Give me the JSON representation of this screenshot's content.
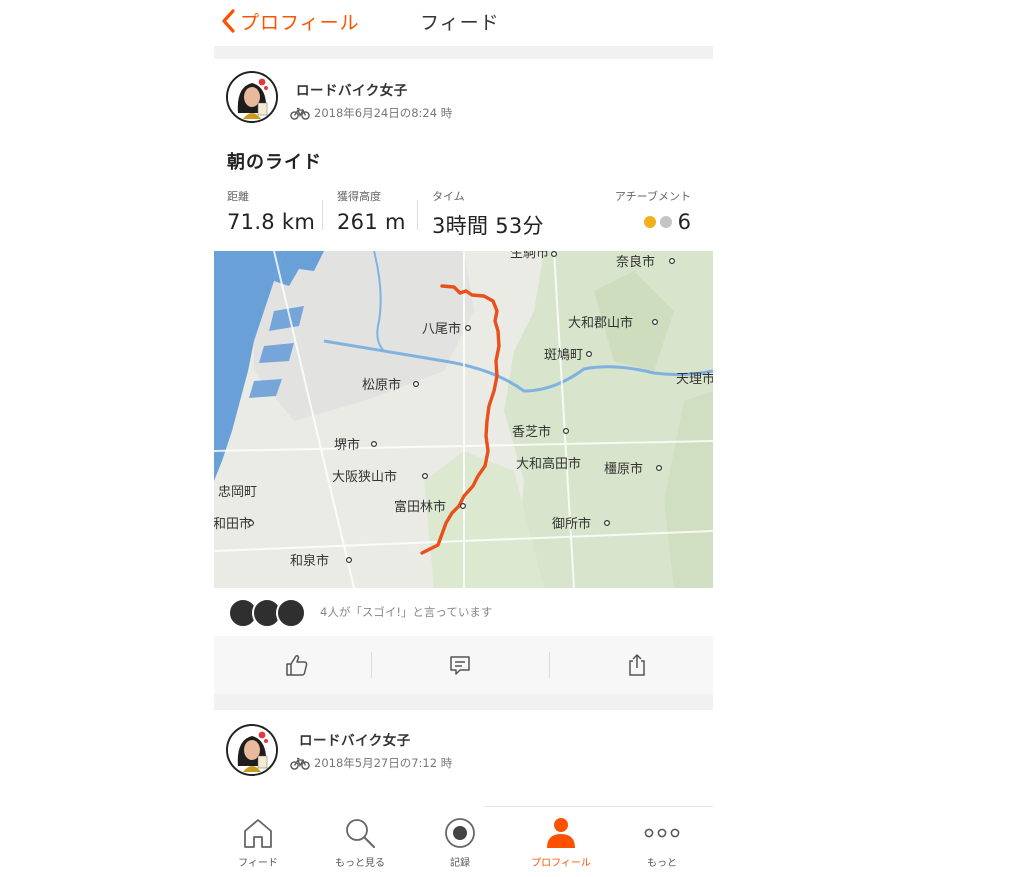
{
  "header": {
    "back_label": "プロフィール",
    "title": "フィード"
  },
  "activities": [
    {
      "athlete": "ロードバイク女子",
      "datetime": "2018年6月24日の8:24 時",
      "title": "朝のライド",
      "stats": [
        {
          "label": "距離",
          "value": "71.8 km"
        },
        {
          "label": "獲得高度",
          "value": "261 m"
        },
        {
          "label": "タイム",
          "value": "3時間 53分"
        }
      ],
      "achievements": {
        "label": "アチーブメント",
        "count": "6"
      },
      "map_labels": [
        "生駒市",
        "奈良市",
        "八尾市",
        "大和郡山市",
        "斑鳩町",
        "松原市",
        "天理市",
        "香芝市",
        "堺市",
        "大和高田市",
        "橿原市",
        "大阪狭山市",
        "忠岡町",
        "富田林市",
        "岸和田市",
        "御所市",
        "和泉市"
      ],
      "kudos_text": "4人が「スゴイ!」と言っています"
    },
    {
      "athlete": "ロードバイク女子",
      "datetime": "2018年5月27日の7:12 時"
    }
  ],
  "tabs": [
    {
      "label": "フィード",
      "icon": "home-icon"
    },
    {
      "label": "もっと見る",
      "icon": "search-icon"
    },
    {
      "label": "記録",
      "icon": "record-icon"
    },
    {
      "label": "プロフィール",
      "icon": "profile-icon",
      "active": true
    },
    {
      "label": "もっと",
      "icon": "more-icon"
    }
  ],
  "colors": {
    "accent": "#fc5200",
    "route": "#e8501c",
    "water": "#6aa0d8"
  }
}
